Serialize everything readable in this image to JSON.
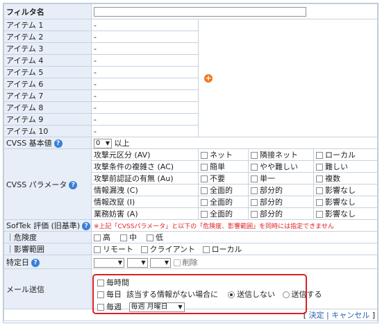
{
  "filter": {
    "label": "フィルタ名",
    "value": ""
  },
  "items": [
    {
      "label": "アイテム 1",
      "value": "-"
    },
    {
      "label": "アイテム 2",
      "value": "-"
    },
    {
      "label": "アイテム 3",
      "value": "-"
    },
    {
      "label": "アイテム 4",
      "value": "-"
    },
    {
      "label": "アイテム 5",
      "value": "-"
    },
    {
      "label": "アイテム 6",
      "value": "-"
    },
    {
      "label": "アイテム 7",
      "value": "-"
    },
    {
      "label": "アイテム 8",
      "value": "-"
    },
    {
      "label": "アイテム 9",
      "value": "-"
    },
    {
      "label": "アイテム 10",
      "value": "-"
    }
  ],
  "add_icon": "plus-circle-icon",
  "cvss_base": {
    "label": "CVSS 基本値",
    "value": "0",
    "suffix": "以上"
  },
  "cvss_params": {
    "label": "CVSS パラメータ",
    "rows": [
      {
        "name": "攻撃元区分 (AV)",
        "opts": [
          "ネット",
          "隣接ネット",
          "ローカル"
        ]
      },
      {
        "name": "攻撃条件の複雑さ (AC)",
        "opts": [
          "簡単",
          "やや難しい",
          "難しい"
        ]
      },
      {
        "name": "攻撃前認証の有無 (Au)",
        "opts": [
          "不要",
          "単一",
          "複数"
        ]
      },
      {
        "name": "情報漏洩 (C)",
        "opts": [
          "全面的",
          "部分的",
          "影響なし"
        ]
      },
      {
        "name": "情報改竄 (I)",
        "opts": [
          "全面的",
          "部分的",
          "影響なし"
        ]
      },
      {
        "name": "業務妨害 (A)",
        "opts": [
          "全面的",
          "部分的",
          "影響なし"
        ]
      }
    ]
  },
  "softek": {
    "label": "SofTek 評価 (旧基準)",
    "warning": "※上記「CVSSパラメータ」と以下の「危険度、影響範囲」を同時には指定できません"
  },
  "severity": {
    "label": "｜危険度",
    "opts": [
      "高",
      "中",
      "低"
    ]
  },
  "scope": {
    "label": "｜影響範囲",
    "opts": [
      "リモート",
      "クライアント",
      "ローカル"
    ]
  },
  "date": {
    "label": "特定日",
    "delete": "削除"
  },
  "mail": {
    "label": "メール送信",
    "hourly": "毎時間",
    "daily": "毎日",
    "daily_note": "該当する情報がない場合に",
    "no_send": "送信しない",
    "send": "送信する",
    "weekly": "毎週",
    "weekly_value": "毎週 月曜日"
  },
  "footer": {
    "open": "[",
    "decide": "決定",
    "sep": "|",
    "cancel": "キャンセル",
    "close": "]"
  },
  "colors": {
    "label_bg": "#e7eef7",
    "border": "#c6d1e0",
    "help": "#3b7fd6",
    "warn": "#e02020",
    "highlight": "#d92020"
  }
}
